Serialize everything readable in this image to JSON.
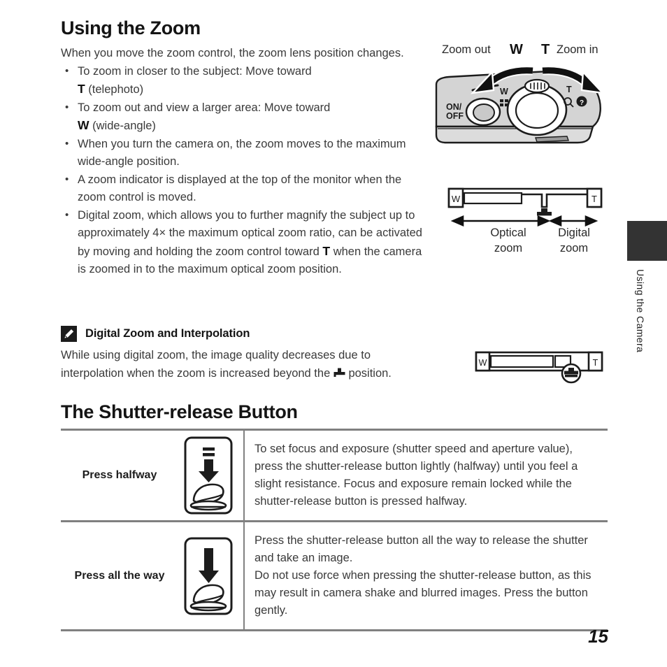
{
  "page": {
    "number": "15",
    "side_tab_label": "Using the Camera"
  },
  "sections": {
    "zoom": {
      "heading": "Using the Zoom",
      "intro": "When you move the zoom control, the zoom lens position changes.",
      "bullets": [
        {
          "prefix": "To zoom in closer to the subject: Move toward",
          "key": "T",
          "suffix": "(telephoto)"
        },
        {
          "prefix": "To zoom out and view a larger area: Move toward",
          "key": "W",
          "suffix": "(wide-angle)",
          "continuation": "When you turn the camera on, the zoom moves to the maximum wide-angle position."
        },
        {
          "text": "A zoom indicator is displayed at the top of the monitor when the zoom control is moved."
        },
        {
          "text_before": "Digital zoom, which allows you to further magnify the subject up to approximately 4× the maximum optical zoom ratio, can be activated by moving and holding the zoom control toward",
          "key": "T",
          "text_after": "when the camera is zoomed in to the maximum optical zoom position."
        }
      ]
    },
    "note": {
      "icon": "pencil-icon",
      "title": "Digital Zoom and Interpolation",
      "body_before": "While using digital zoom, the image quality decreases due to interpolation when the zoom is increased beyond the",
      "inline_icon": "interpolation-marker-icon",
      "body_after": "position."
    },
    "shutter": {
      "heading": "The Shutter-release Button",
      "rows": [
        {
          "label": "Press halfway",
          "icon": "press-halfway-icon",
          "paragraphs": [
            "To set focus and exposure (shutter speed and aperture value), press the shutter-release button lightly (halfway) until you feel a slight resistance. Focus and exposure remain locked while the shutter-release button is pressed halfway."
          ]
        },
        {
          "label": "Press all the way",
          "icon": "press-all-the-way-icon",
          "paragraphs": [
            "Press the shutter-release button all the way to release the shutter and take an image.",
            "Do not use force when pressing the shutter-release button, as this may result in camera shake and blurred images. Press the button gently."
          ]
        }
      ]
    }
  },
  "figures": {
    "camera": {
      "zoom_out_label": "Zoom out",
      "w_label": "W",
      "t_label": "T",
      "zoom_in_label": "Zoom in",
      "power_label_line1": "ON/",
      "power_label_line2": "OFF"
    },
    "zoom_indicator": {
      "wide_marker": "W",
      "tele_marker": "T",
      "optical_label_line1": "Optical",
      "optical_label_line2": "zoom",
      "digital_label_line1": "Digital",
      "digital_label_line2": "zoom"
    },
    "zoom_indicator_interpolation": {
      "wide_marker": "W",
      "tele_marker": "T"
    }
  },
  "colors": {
    "text": "#3a3a3a",
    "heading": "#141414",
    "rule": "#808080",
    "tab": "#333333",
    "camera_body": "#d4d4d4"
  }
}
